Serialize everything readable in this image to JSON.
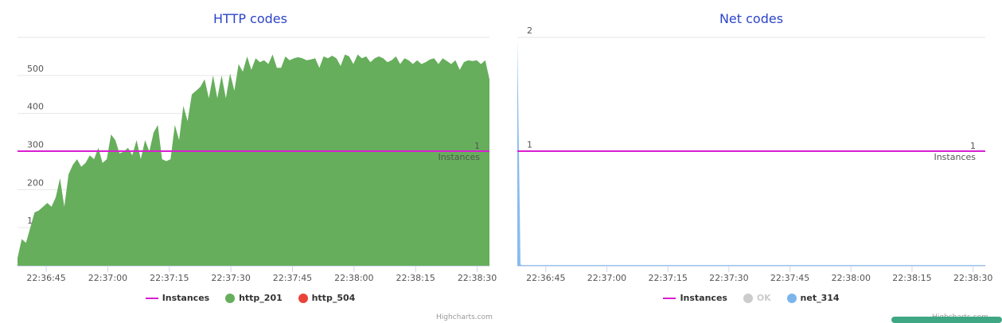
{
  "colors": {
    "title": "#2c44c8",
    "instances": "#d91ed1",
    "http_201": "#66ae5c",
    "http_504": "#e8443a",
    "ok": "#cccccc",
    "net_314": "#7cb5ec"
  },
  "credits": "Highcharts.com",
  "chart_data": [
    {
      "type": "area",
      "title": "HTTP codes",
      "x_ticks": [
        "22:36:45",
        "22:37:00",
        "22:37:15",
        "22:37:30",
        "22:37:45",
        "22:38:00",
        "22:38:15",
        "22:38:30"
      ],
      "y_ticks": [
        "100",
        "200",
        "300",
        "400",
        "500"
      ],
      "ylim": [
        0,
        600
      ],
      "grid": true,
      "legend_position": "bottom-center",
      "series": [
        {
          "name": "Instances",
          "type": "line",
          "y_axis": "secondary",
          "values": [
            1
          ],
          "label": {
            "value": "1",
            "text": "Instances"
          }
        },
        {
          "name": "http_201",
          "type": "area",
          "x_range": [
            "22:36:38",
            "22:38:33"
          ],
          "values": [
            20,
            70,
            60,
            100,
            140,
            145,
            155,
            165,
            155,
            180,
            230,
            155,
            240,
            265,
            280,
            260,
            270,
            290,
            280,
            310,
            270,
            280,
            345,
            330,
            295,
            300,
            310,
            290,
            330,
            280,
            330,
            300,
            350,
            370,
            280,
            275,
            280,
            370,
            330,
            420,
            380,
            450,
            460,
            470,
            490,
            440,
            500,
            440,
            500,
            440,
            505,
            460,
            530,
            510,
            550,
            515,
            545,
            535,
            540,
            530,
            555,
            520,
            520,
            550,
            540,
            545,
            548,
            545,
            540,
            542,
            545,
            520,
            550,
            545,
            552,
            545,
            525,
            555,
            550,
            530,
            555,
            545,
            550,
            535,
            545,
            550,
            545,
            535,
            540,
            550,
            530,
            545,
            540,
            530,
            540,
            530,
            535,
            542,
            545,
            530,
            545,
            538,
            530,
            540,
            515,
            535,
            540,
            538,
            540,
            530,
            540,
            490
          ],
          "approx_values": [
            20,
            70,
            60,
            100,
            140,
            145,
            155,
            165,
            155,
            180,
            230,
            155,
            240,
            265,
            280,
            260,
            270,
            290,
            280,
            310,
            270,
            280,
            345,
            330,
            295,
            300,
            310,
            290,
            330,
            280,
            330,
            300,
            350,
            370,
            280,
            275,
            280,
            370,
            330,
            420,
            380,
            450,
            460,
            470,
            490,
            440,
            500,
            440,
            500,
            440,
            505,
            460,
            530,
            510,
            550,
            515,
            545,
            535,
            540,
            530,
            555,
            520,
            520,
            550,
            540,
            545,
            548,
            545,
            540,
            542,
            545,
            520,
            550,
            545,
            552,
            545,
            525,
            555,
            550,
            530,
            555,
            545,
            550,
            535,
            545,
            550,
            545,
            535,
            540,
            550,
            530,
            545,
            540,
            530,
            540,
            530,
            535,
            542,
            545,
            530,
            545,
            538,
            530,
            540,
            515,
            535,
            540,
            538,
            540,
            530,
            540,
            490
          ]
        },
        {
          "name": "http_504",
          "type": "area",
          "values": []
        }
      ]
    },
    {
      "type": "area",
      "title": "Net codes",
      "x_ticks": [
        "22:36:45",
        "22:37:00",
        "22:37:15",
        "22:37:30",
        "22:37:45",
        "22:38:00",
        "22:38:15",
        "22:38:30"
      ],
      "y_ticks": [
        "1",
        "2"
      ],
      "ylim": [
        0,
        2
      ],
      "grid": true,
      "legend_position": "bottom-center",
      "series": [
        {
          "name": "Instances",
          "type": "line",
          "y_axis": "secondary",
          "values": [
            1
          ],
          "label": {
            "value": "1",
            "text": "Instances"
          }
        },
        {
          "name": "OK",
          "type": "area",
          "values": [],
          "hidden": true
        },
        {
          "name": "net_314",
          "type": "area",
          "x_range": [
            "22:36:38",
            "22:38:33"
          ],
          "values": [
            1.98,
            0.02,
            0,
            0
          ]
        }
      ]
    }
  ]
}
